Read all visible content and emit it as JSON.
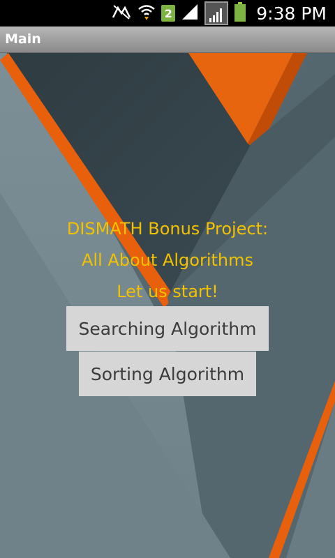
{
  "status_bar": {
    "time": "9:38 PM",
    "notification_count": "2",
    "icons": [
      "notifications-off-icon",
      "wifi-icon",
      "signal-icon",
      "battery-icon"
    ]
  },
  "app_bar": {
    "title": "Main"
  },
  "main": {
    "line1": "DISMATH Bonus Project:",
    "line2": "All About Algorithms",
    "line3": "Let us start!",
    "buttons": [
      {
        "label": "Searching Algorithm"
      },
      {
        "label": "Sorting Algorithm"
      }
    ]
  },
  "colors": {
    "headline": "#f2c200",
    "accent_orange": "#e85f0c",
    "button_bg": "#d6d6d6"
  }
}
